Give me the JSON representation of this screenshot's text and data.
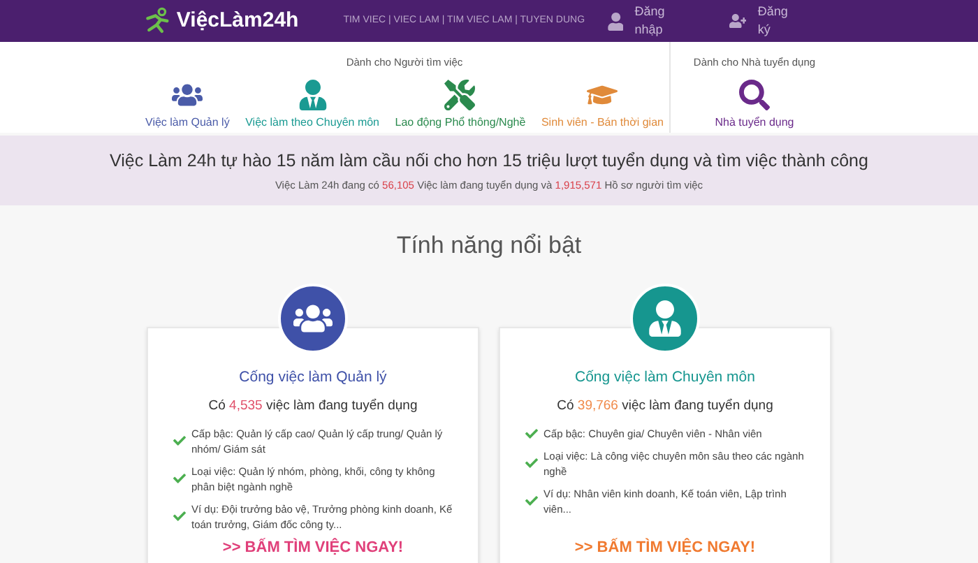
{
  "header": {
    "logo": "ViệcLàm24h",
    "links": "TIM VIEC | VIEC LAM | TIM VIEC LAM | TUYEN DUNG",
    "actions": [
      {
        "kind": "login",
        "label": "Đăng nhập"
      },
      {
        "kind": "register",
        "label": "Đăng ký"
      }
    ]
  },
  "nav": {
    "seeker_heading": "Dành cho Người tìm việc",
    "employer_heading": "Dành cho Nhà tuyển dụng",
    "seeker_items": [
      {
        "kind": "managers",
        "label": "Việc làm Quản lý",
        "color": "#4a5ba8"
      },
      {
        "kind": "specialist",
        "label": "Việc làm theo Chuyên môn",
        "color": "#1a9a92"
      },
      {
        "kind": "tools",
        "label": "Lao động Phổ thông/Nghề",
        "color": "#2b8a4e"
      },
      {
        "kind": "student",
        "label": "Sinh viên - Bán thời gian",
        "color": "#e08a3a"
      }
    ],
    "employer_item": {
      "kind": "search",
      "label": "Nhà tuyển dụng",
      "color": "#6a2a8a"
    }
  },
  "banner": {
    "title": "Việc Làm 24h tự hào 15 năm làm cầu nối cho hơn 15 triệu lượt tuyển dụng và tìm việc thành công",
    "before": "Việc Làm 24h đang có",
    "jobs_count": "56,105",
    "middle": "Việc làm đang tuyển dụng và",
    "profiles_count": "1,915,571",
    "after": "Hồ sơ người tìm việc"
  },
  "section_title": "Tính năng nổi bật",
  "cards": [
    {
      "kind": "managers",
      "color": "#3f51a8",
      "title": "Cống việc làm Quản lý",
      "count_before": "Có",
      "count": {
        "text": "4,535",
        "color": "#e0506a"
      },
      "count_after": "việc làm đang tuyển dụng",
      "bullets": [
        "Cấp bậc: Quản lý cấp cao/ Quản lý cấp trung/ Quản lý nhóm/ Giám sát",
        "Loại việc: Quản lý nhóm, phòng, khối, công ty không phân biệt ngành nghề",
        "Ví dụ: Đội trưởng bảo vệ, Trưởng phòng kinh doanh, Kế toán trưởng, Giám đốc công ty..."
      ],
      "button": {
        "label": ">> BẤM TÌM VIỆC NGAY!",
        "color": "#e0407a"
      }
    },
    {
      "kind": "specialist",
      "color": "#16968f",
      "title": "Cống việc làm Chuyên môn",
      "count_before": "Có",
      "count": {
        "text": "39,766",
        "color": "#f08a4a"
      },
      "count_after": "việc làm đang tuyển dụng",
      "bullets": [
        "Cấp bậc: Chuyên gia/ Chuyên viên - Nhân viên",
        "Loại việc: Là công việc chuyên môn sâu theo các ngành nghề",
        "Ví dụ: Nhân viên kinh doanh, Kế toán viên, Lập trình viên..."
      ],
      "button": {
        "label": ">> BẤM TÌM VIỆC NGAY!",
        "color": "#f07a30"
      }
    }
  ]
}
